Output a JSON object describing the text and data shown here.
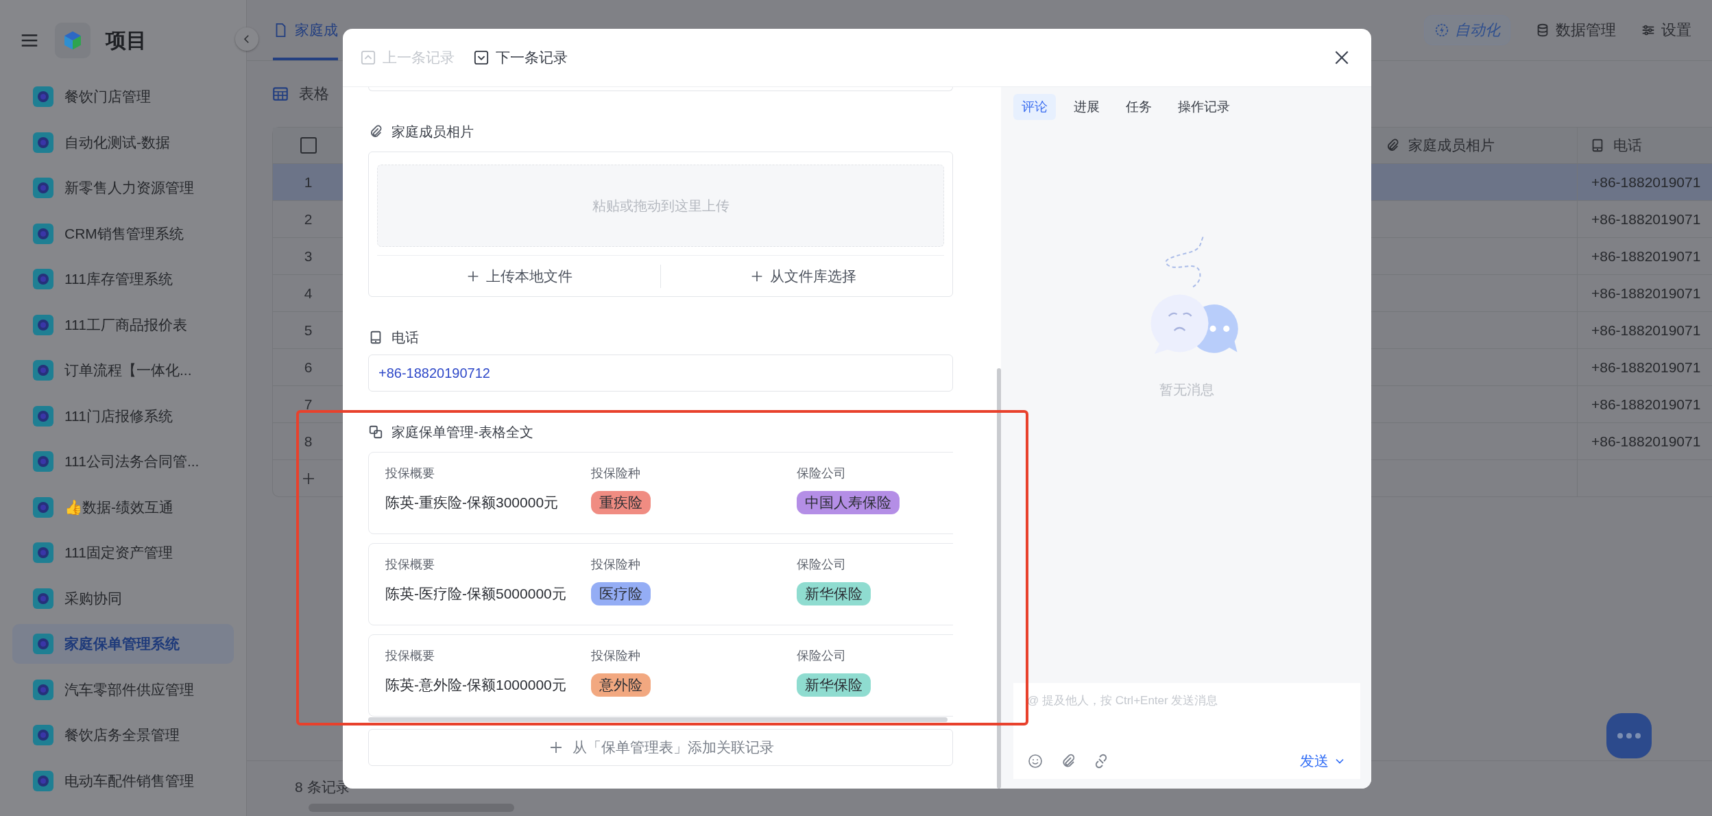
{
  "sidebar": {
    "title": "项目",
    "items": [
      {
        "label": "餐饮门店管理",
        "selected": false
      },
      {
        "label": "自动化测试-数据",
        "selected": false
      },
      {
        "label": "新零售人力资源管理",
        "selected": false
      },
      {
        "label": "CRM销售管理系统",
        "selected": false
      },
      {
        "label": "111库存管理系统",
        "selected": false
      },
      {
        "label": "111工厂商品报价表",
        "selected": false
      },
      {
        "label": "订单流程【一体化...",
        "selected": false
      },
      {
        "label": "111门店报修系统",
        "selected": false
      },
      {
        "label": "111公司法务合同管...",
        "selected": false
      },
      {
        "label": "👍数据-绩效互通",
        "selected": false
      },
      {
        "label": "111固定资产管理",
        "selected": false
      },
      {
        "label": "采购协同",
        "selected": false
      },
      {
        "label": "家庭保单管理系统",
        "selected": true
      },
      {
        "label": "汽车零部件供应管理",
        "selected": false
      },
      {
        "label": "餐饮店务全景管理",
        "selected": false
      },
      {
        "label": "电动车配件销售管理",
        "selected": false
      }
    ]
  },
  "tabs": [
    {
      "label": "家庭成",
      "selected": true
    }
  ],
  "toolbar": {
    "automation": "自动化",
    "data_management": "数据管理",
    "settings": "设置"
  },
  "view": {
    "label": "表格"
  },
  "table": {
    "select_all_checked": false,
    "columns": [
      "家庭成员相片",
      "电话"
    ],
    "rows": [
      {
        "number": "1",
        "selected": true,
        "phone": "+86-1882019071"
      },
      {
        "number": "2",
        "selected": false,
        "phone": "+86-1882019071"
      },
      {
        "number": "3",
        "selected": false,
        "phone": "+86-1882019071"
      },
      {
        "number": "4",
        "selected": false,
        "phone": "+86-1882019071"
      },
      {
        "number": "5",
        "selected": false,
        "phone": "+86-1882019071"
      },
      {
        "number": "6",
        "selected": false,
        "phone": "+86-1882019071"
      },
      {
        "number": "7",
        "selected": false,
        "phone": "+86-1882019071"
      },
      {
        "number": "8",
        "selected": false,
        "phone": "+86-1882019071"
      }
    ]
  },
  "footer": {
    "record_count": "8 条记录"
  },
  "record_dialog": {
    "prev": {
      "label": "上一条记录",
      "disabled": true
    },
    "next": {
      "label": "下一条记录",
      "disabled": false
    },
    "fields": [
      {
        "kind": "attachment",
        "label": "家庭成员相片",
        "dropzone": "粘贴或拖动到这里上传",
        "actions": [
          "上传本地文件",
          "从文件库选择"
        ]
      },
      {
        "kind": "phone",
        "label": "电话",
        "value": "+86-18820190712"
      },
      {
        "kind": "linked",
        "label": "家庭保单管理-表格全文",
        "add_button": "从「保单管理表」添加关联记录",
        "records": [
          {
            "fields": [
              {
                "kind": "text",
                "label": "投保概要",
                "value": "陈英-重疾险-保额300000元"
              },
              {
                "kind": "tag",
                "label": "投保险种",
                "value": "重疾险",
                "color": "#f08c82"
              },
              {
                "kind": "tag",
                "label": "保险公司",
                "value": "中国人寿保险",
                "color": "#b48ee6"
              }
            ]
          },
          {
            "fields": [
              {
                "kind": "text",
                "label": "投保概要",
                "value": "陈英-医疗险-保额5000000元"
              },
              {
                "kind": "tag",
                "label": "投保险种",
                "value": "医疗险",
                "color": "#94adf5"
              },
              {
                "kind": "tag",
                "label": "保险公司",
                "value": "新华保险",
                "color": "#8fdcd0"
              }
            ]
          },
          {
            "fields": [
              {
                "kind": "text",
                "label": "投保概要",
                "value": "陈英-意外险-保额1000000元"
              },
              {
                "kind": "tag",
                "label": "投保险种",
                "value": "意外险",
                "color": "#f2a880"
              },
              {
                "kind": "tag",
                "label": "保险公司",
                "value": "新华保险",
                "color": "#8fdcd0"
              }
            ]
          }
        ]
      }
    ],
    "activity": {
      "tabs": [
        {
          "label": "评论",
          "selected": true
        },
        {
          "label": "进展",
          "selected": false
        },
        {
          "label": "任务",
          "selected": false
        },
        {
          "label": "操作记录",
          "selected": false
        }
      ],
      "empty_text": "暂无消息",
      "comment_placeholder": "@ 提及他人，按 Ctrl+Enter 发送消息",
      "send_label": "发送"
    }
  }
}
